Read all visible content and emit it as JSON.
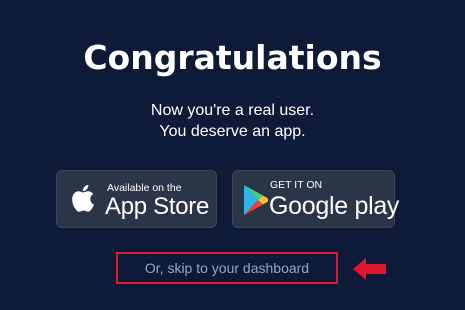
{
  "heading": {
    "title": "Congratulations",
    "line1": "Now you're a real user.",
    "line2": "You deserve an app."
  },
  "app_store": {
    "small_text": "Available on the",
    "big_text": "App Store",
    "icon": "apple-icon"
  },
  "google_play": {
    "small_text": "GET IT ON",
    "big_text": "Google play",
    "icon": "google-play-icon"
  },
  "skip": {
    "label": "Or, skip to your dashboard"
  },
  "colors": {
    "background": "#0d1b38",
    "button_bg": "#2a3548",
    "highlight": "#e0182c",
    "link": "#9aa6bd"
  }
}
